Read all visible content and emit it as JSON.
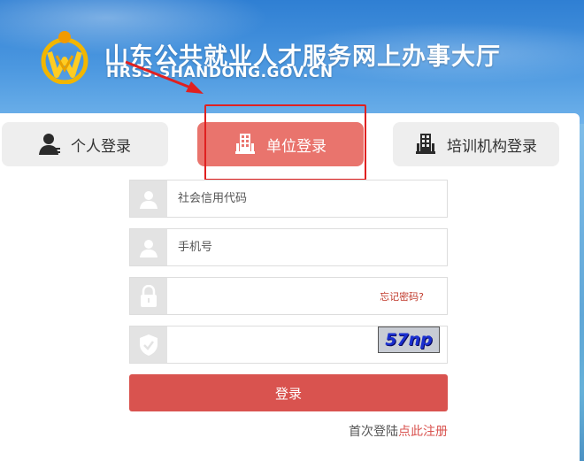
{
  "header": {
    "title": "山东公共就业人才服务网上办事大厅",
    "domain": "HRSS.SHANDONG.GOV.CN",
    "logo_icon": "provincial-logo-icon"
  },
  "tabs": [
    {
      "label": "个人登录",
      "icon": "person-icon",
      "active": false
    },
    {
      "label": "单位登录",
      "icon": "building-icon",
      "active": true
    },
    {
      "label": "培训机构登录",
      "icon": "building-icon",
      "active": false
    }
  ],
  "form": {
    "credit_code_placeholder": "社会信用代码",
    "phone_placeholder": "手机号",
    "password_placeholder": "",
    "forgot_password": "忘记密码?",
    "captcha_placeholder": "",
    "captcha_text": "57np",
    "login_button": "登录"
  },
  "register": {
    "prefix": "首次登陆",
    "link": "点此注册"
  },
  "colors": {
    "accent": "#d9534f",
    "active_tab": "#e9746d",
    "annotation": "#e02020"
  }
}
